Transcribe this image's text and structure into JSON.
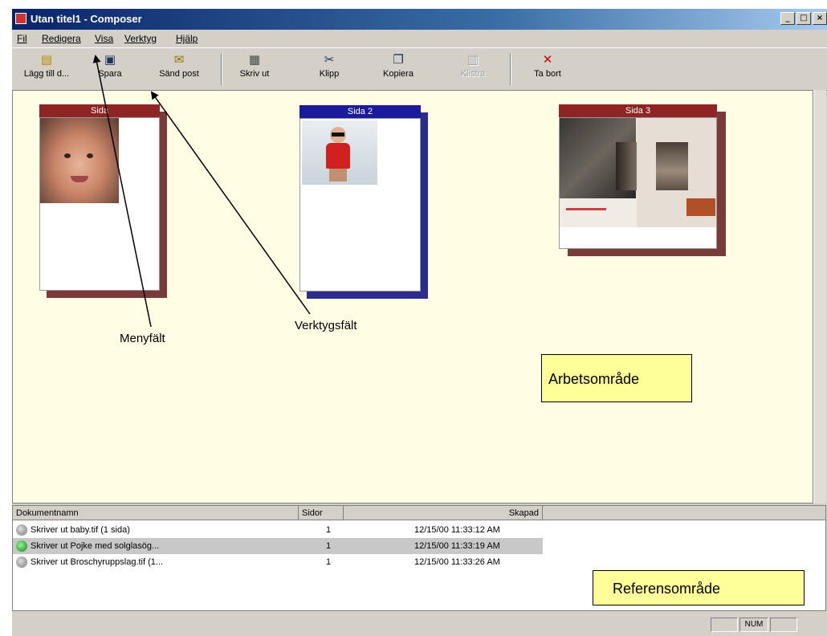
{
  "window": {
    "title": "Utan titel1 - Composer"
  },
  "title_buttons": {
    "minimize": "_",
    "maximize": "□",
    "close": "×"
  },
  "menu": [
    "Fil",
    "Redigera",
    "Visa",
    "Verktyg",
    "Hjälp"
  ],
  "toolbar": {
    "add_doc": "Lägg till d...",
    "save": "Spara",
    "send_mail": "Sänd post",
    "print": "Skriv ut",
    "cut": "Klipp",
    "copy": "Kopiera",
    "paste": "Klistra",
    "delete": "Ta bort"
  },
  "toolbar_icons": [
    "add-document-icon",
    "floppy-disk-icon",
    "envelope-icon",
    "printer-icon",
    "scissors-icon",
    "copy-icon",
    "paste-icon",
    "delete-x-icon"
  ],
  "pages": [
    {
      "label": "Sida",
      "header_color": "#8e2424"
    },
    {
      "label": "Sida 2",
      "header_color": "#1a1a9a"
    },
    {
      "label": "Sida 3",
      "header_color": "#8e2424"
    }
  ],
  "annotations": {
    "menu_bar": "Menyfält",
    "toolbar": "Verktygsfält",
    "work_area": "Arbetsområde",
    "reference_area": "Referensområde"
  },
  "ref_table": {
    "columns": [
      "Dokumentnamn",
      "Sidor",
      "Skapad"
    ],
    "rows": [
      {
        "name": "Skriver ut baby.tif (1 sida)",
        "pages": "1",
        "created": "12/15/00 11:33:12 AM",
        "selected": false
      },
      {
        "name": "Skriver ut Pojke med solglasög...",
        "pages": "1",
        "created": "12/15/00 11:33:19 AM",
        "selected": true
      },
      {
        "name": "Skriver ut Broschyruppslag.tif (1...",
        "pages": "1",
        "created": "12/15/00 11:33:26 AM",
        "selected": false
      }
    ]
  },
  "status": {
    "num": "NUM"
  },
  "colors": {
    "workspace": "#fffde3",
    "callout": "#ffff99",
    "titlebar": "#0a246a"
  }
}
